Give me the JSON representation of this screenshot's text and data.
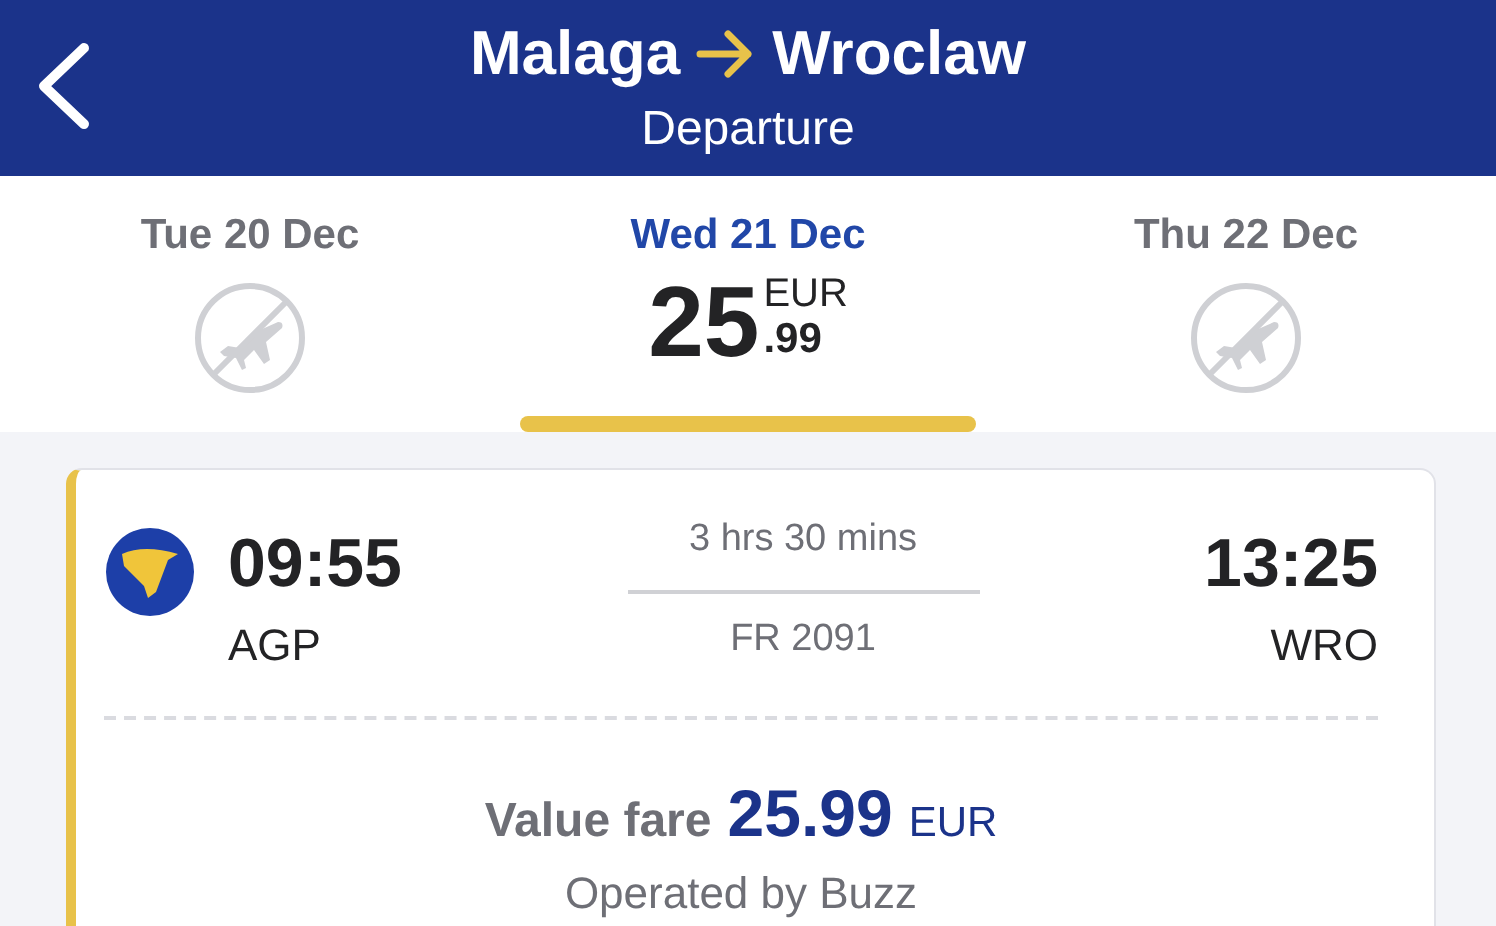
{
  "header": {
    "origin": "Malaga",
    "destination": "Wroclaw",
    "subtitle": "Departure"
  },
  "dates": [
    {
      "label": "Tue 20 Dec",
      "selected": false,
      "kind": "unavailable"
    },
    {
      "label": "Wed 21 Dec",
      "selected": true,
      "kind": "price",
      "price_whole": "25",
      "price_cents": ".99",
      "currency": "EUR"
    },
    {
      "label": "Thu 22 Dec",
      "selected": false,
      "kind": "unavailable"
    }
  ],
  "flight": {
    "depart_time": "09:55",
    "depart_airport": "AGP",
    "duration": "3 hrs 30 mins",
    "flight_number": "FR 2091",
    "arrive_time": "13:25",
    "arrive_airport": "WRO",
    "fare_label": "Value fare",
    "fare_amount": "25.99",
    "fare_currency": "EUR",
    "operator": "Operated by Buzz"
  }
}
